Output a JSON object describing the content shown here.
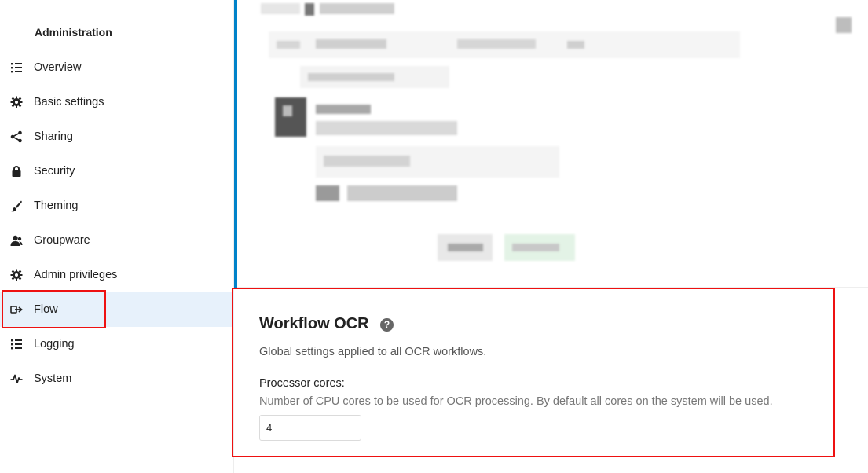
{
  "sidebar": {
    "heading": "Administration",
    "items": [
      {
        "label": "Overview",
        "icon": "list-icon"
      },
      {
        "label": "Basic settings",
        "icon": "gear-icon"
      },
      {
        "label": "Sharing",
        "icon": "share-icon"
      },
      {
        "label": "Security",
        "icon": "lock-icon"
      },
      {
        "label": "Theming",
        "icon": "brush-icon"
      },
      {
        "label": "Groupware",
        "icon": "user-group-icon"
      },
      {
        "label": "Admin privileges",
        "icon": "gear-icon"
      },
      {
        "label": "Flow",
        "icon": "flow-icon",
        "active": true
      },
      {
        "label": "Logging",
        "icon": "list-icon"
      },
      {
        "label": "System",
        "icon": "pulse-icon"
      }
    ]
  },
  "ocr": {
    "title": "Workflow OCR",
    "help_symbol": "?",
    "description": "Global settings applied to all OCR workflows.",
    "cores_label": "Processor cores:",
    "cores_hint": "Number of CPU cores to be used for OCR processing. By default all cores on the system will be used.",
    "cores_value": "4"
  },
  "colors": {
    "accent": "#0082c9",
    "highlight": "#ee1111",
    "active_bg": "#e7f1fb"
  }
}
